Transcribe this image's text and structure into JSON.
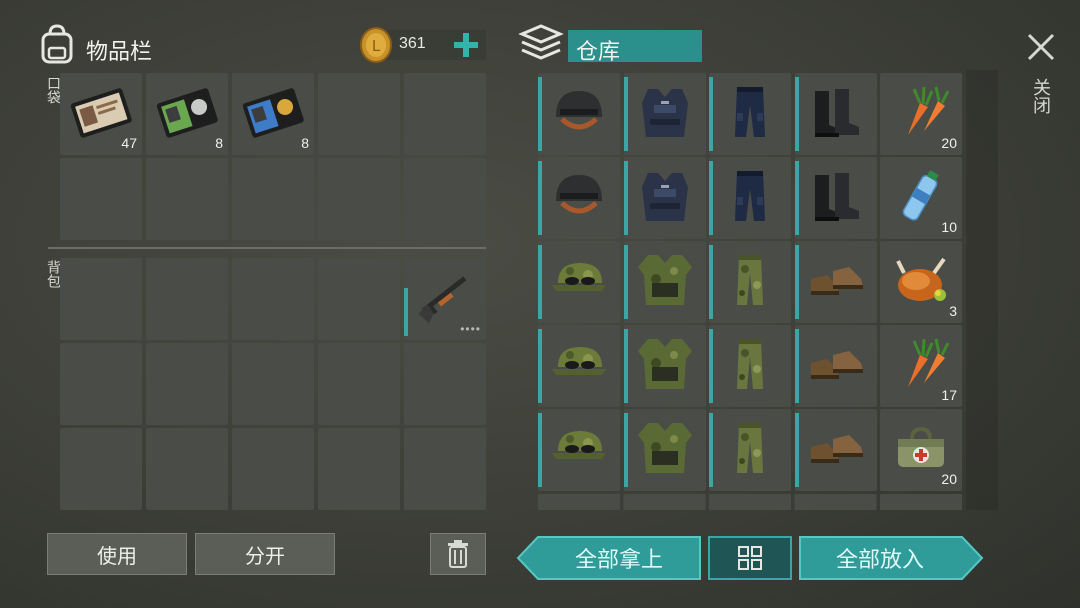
{
  "inventory": {
    "title": "物品栏",
    "coins": "361",
    "pocket_label": "口袋",
    "backpack_label": "背包",
    "pocket_items": [
      {
        "name": "Police ID card (brown)",
        "count": "47"
      },
      {
        "name": "Police ID card (green)",
        "count": "8"
      },
      {
        "name": "Police ID card (blue)",
        "count": "8"
      }
    ],
    "backpack_items": [
      {
        "name": "Shotgun",
        "durability": "••••"
      }
    ],
    "use_button": "使用",
    "split_button": "分开"
  },
  "storage": {
    "title": "仓库",
    "rows": [
      [
        {
          "icon": "helmet-icon",
          "count": ""
        },
        {
          "icon": "police-vest-icon",
          "count": ""
        },
        {
          "icon": "police-pants-icon",
          "count": ""
        },
        {
          "icon": "boots-icon",
          "count": ""
        },
        {
          "icon": "carrot-icon",
          "count": "20"
        }
      ],
      [
        {
          "icon": "helmet-icon",
          "count": ""
        },
        {
          "icon": "police-vest-icon",
          "count": ""
        },
        {
          "icon": "police-pants-icon",
          "count": ""
        },
        {
          "icon": "boots-icon",
          "count": ""
        },
        {
          "icon": "water-bottle-icon",
          "count": "10"
        }
      ],
      [
        {
          "icon": "camo-cap-icon",
          "count": ""
        },
        {
          "icon": "camo-jacket-icon",
          "count": ""
        },
        {
          "icon": "camo-pants-icon",
          "count": ""
        },
        {
          "icon": "shoes-icon",
          "count": ""
        },
        {
          "icon": "roast-chicken-icon",
          "count": "3"
        }
      ],
      [
        {
          "icon": "camo-cap-icon",
          "count": ""
        },
        {
          "icon": "camo-jacket-icon",
          "count": ""
        },
        {
          "icon": "camo-pants-icon",
          "count": ""
        },
        {
          "icon": "shoes-icon",
          "count": ""
        },
        {
          "icon": "carrot-icon",
          "count": "17"
        }
      ],
      [
        {
          "icon": "camo-cap-icon",
          "count": ""
        },
        {
          "icon": "camo-jacket-icon",
          "count": ""
        },
        {
          "icon": "camo-pants-icon",
          "count": ""
        },
        {
          "icon": "shoes-icon",
          "count": ""
        },
        {
          "icon": "medkit-bag-icon",
          "count": "20"
        }
      ]
    ],
    "take_all_button": "全部拿上",
    "put_all_button": "全部放入"
  },
  "close_label": "关闭",
  "colors": {
    "accent": "#2f9c99",
    "accent_bright": "#4fc5c2",
    "slot": "#4a4c47"
  }
}
